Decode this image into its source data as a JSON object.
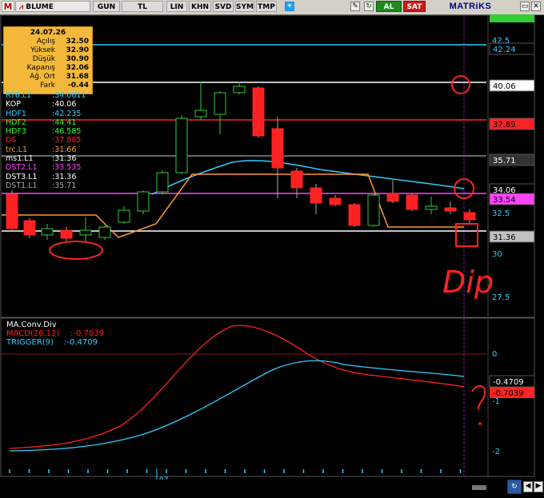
{
  "toolbar": {
    "m_label": "M",
    "chart_label": "BLUME",
    "buttons": [
      "GUN",
      "TL",
      "LIN",
      "KHN",
      "SVD",
      "SYM",
      "TMP"
    ],
    "al_label": "AL",
    "sat_label": "SAT",
    "brand": "MATRiKS"
  },
  "info_box": {
    "date": "24.07.26",
    "rows": [
      {
        "label": "Açılış",
        "value": "32.50"
      },
      {
        "label": "Yüksek",
        "value": "32.90"
      },
      {
        "label": "Düşük",
        "value": "30.90"
      },
      {
        "label": "Kapanış",
        "value": "32.06"
      },
      {
        "label": "Ağ. Ort",
        "value": "31.68"
      },
      {
        "label": "Fark",
        "value": "-0.44"
      }
    ]
  },
  "indicators": [
    {
      "name": "RY6.L1",
      "value": ":34.0611",
      "color": "#33ccff"
    },
    {
      "name": "KOP",
      "value": ":40.06",
      "color": "#ffffff"
    },
    {
      "name": "HDF1",
      "value": ":42.235",
      "color": "#33ccff"
    },
    {
      "name": "HDF2",
      "value": ":44.41",
      "color": "#33ff33"
    },
    {
      "name": "HDF3",
      "value": ":46.585",
      "color": "#33ff33"
    },
    {
      "name": "DS",
      "value": ":37.885",
      "color": "#ff2222"
    },
    {
      "name": "trc.L1",
      "value": ":31.66",
      "color": "#ff9933"
    },
    {
      "name": "ms1.L1",
      "value": ":31.36",
      "color": "#ffffff"
    },
    {
      "name": "DST2.L1",
      "value": ":33.535",
      "color": "#ff44ff"
    },
    {
      "name": "DST3.L1",
      "value": ":31.36",
      "color": "#ffffff"
    },
    {
      "name": "DST1.L1",
      "value": ":35.71",
      "color": "#aaaaaa"
    }
  ],
  "price_axis": {
    "ticks": [
      "42.5",
      "32.5",
      "30",
      "27.5"
    ]
  },
  "price_badges": [
    {
      "text": "42.24",
      "bg": "#000000",
      "fg": "#33ccff"
    },
    {
      "text": "40.06",
      "bg": "#ffffff",
      "fg": "#000000"
    },
    {
      "text": "37.89",
      "bg": "#ff2222",
      "fg": "#000000"
    },
    {
      "text": "35.71",
      "bg": "#333333",
      "fg": "#ffffff"
    },
    {
      "text": "34.06",
      "bg": "#000000",
      "fg": "#ffffff"
    },
    {
      "text": "33.54",
      "bg": "#ff44ff",
      "fg": "#000000"
    },
    {
      "text": "31.36",
      "bg": "#c0c0c0",
      "fg": "#000000"
    }
  ],
  "macd_panel": {
    "title": "MA.Conv.Div",
    "macd_label": "MACD(26,12)",
    "macd_value": ":-0.7039",
    "trigger_label": "TRIGGER(9)",
    "trigger_value": ":-0.4709",
    "axis_ticks": [
      "0",
      "-1",
      "-2"
    ],
    "badge_trigger": "-0.4709",
    "badge_macd": "-0.7039"
  },
  "x_axis": {
    "label": "07"
  },
  "annotation": {
    "text": "Dip"
  },
  "colors": {
    "up": "#33cc33",
    "down": "#ff2222",
    "trigger": "#33ccff",
    "macd": "#ff2222"
  }
}
